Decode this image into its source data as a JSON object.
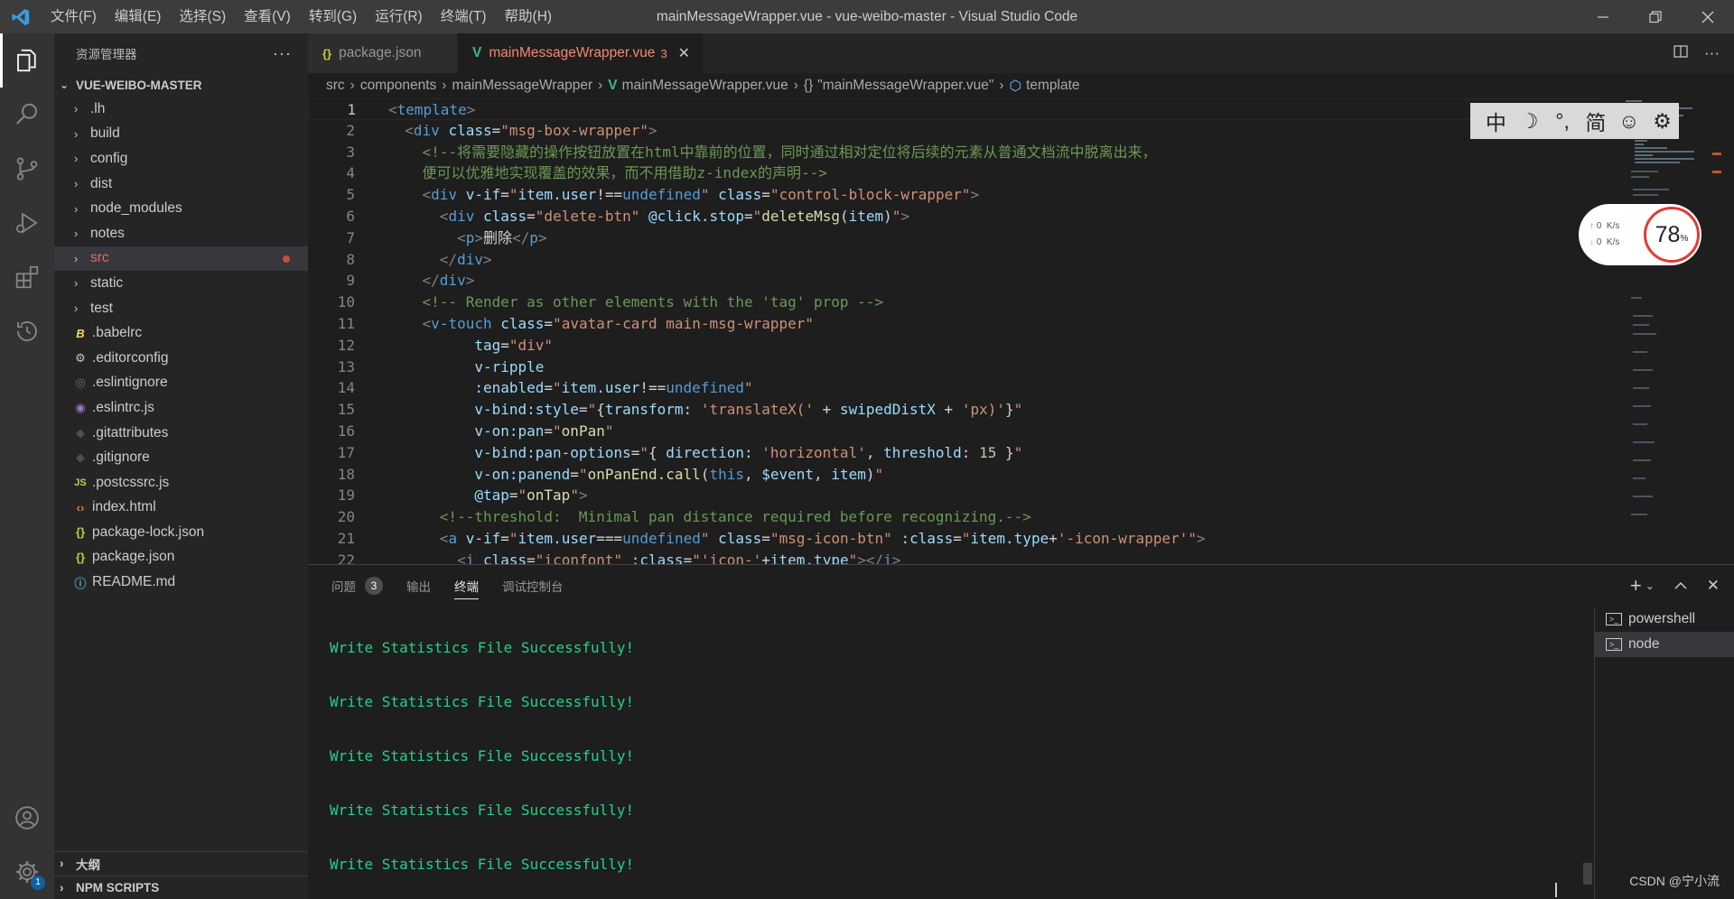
{
  "titlebar": {
    "menus": [
      "文件(F)",
      "编辑(E)",
      "选择(S)",
      "查看(V)",
      "转到(G)",
      "运行(R)",
      "终端(T)",
      "帮助(H)"
    ],
    "title": "mainMessageWrapper.vue - vue-weibo-master - Visual Studio Code"
  },
  "activity": {
    "settings_badge": "1"
  },
  "sidebar": {
    "header": "资源管理器",
    "more": "···",
    "root": "VUE-WEIBO-MASTER",
    "items": [
      {
        "label": ".lh",
        "type": "folder"
      },
      {
        "label": "build",
        "type": "folder"
      },
      {
        "label": "config",
        "type": "folder"
      },
      {
        "label": "dist",
        "type": "folder"
      },
      {
        "label": "node_modules",
        "type": "folder"
      },
      {
        "label": "notes",
        "type": "folder"
      },
      {
        "label": "src",
        "type": "folder"
      },
      {
        "label": "static",
        "type": "folder"
      },
      {
        "label": "test",
        "type": "folder"
      },
      {
        "label": ".babelrc",
        "type": "file"
      },
      {
        "label": ".editorconfig",
        "type": "file"
      },
      {
        "label": ".eslintignore",
        "type": "file"
      },
      {
        "label": ".eslintrc.js",
        "type": "file"
      },
      {
        "label": ".gitattributes",
        "type": "file"
      },
      {
        "label": ".gitignore",
        "type": "file"
      },
      {
        "label": ".postcssrc.js",
        "type": "file"
      },
      {
        "label": "index.html",
        "type": "file"
      },
      {
        "label": "package-lock.json",
        "type": "file"
      },
      {
        "label": "package.json",
        "type": "file"
      },
      {
        "label": "README.md",
        "type": "file"
      }
    ],
    "outline": "大纲",
    "npm": "NPM SCRIPTS"
  },
  "tabs": [
    {
      "label": "package.json",
      "icon": "{}"
    },
    {
      "label": "mainMessageWrapper.vue",
      "icon": "V",
      "errors": "3"
    }
  ],
  "breadcrumb": [
    "src",
    "components",
    "mainMessageWrapper",
    "mainMessageWrapper.vue",
    "\"mainMessageWrapper.vue\"",
    "template"
  ],
  "code": {
    "line_numbers": [
      "1",
      "2",
      "3",
      "4",
      "5",
      "6",
      "7",
      "8",
      "9",
      "10",
      "11",
      "12",
      "13",
      "14",
      "15",
      "16",
      "17",
      "18",
      "19",
      "20",
      "21",
      "22"
    ]
  },
  "ime": [
    "中",
    "☽",
    "°,",
    "简",
    "☺",
    "⚙"
  ],
  "net": {
    "up": "0",
    "down": "0",
    "unit": "K/s",
    "percent": "78",
    "pct_sign": "%"
  },
  "panel": {
    "tabs": [
      "问题",
      "输出",
      "终端",
      "调试控制台"
    ],
    "problems_count": "3",
    "terminal_lines": [
      "Write Statistics File Successfully!",
      "Write Statistics File Successfully!",
      "Write Statistics File Successfully!",
      "Write Statistics File Successfully!",
      "Write Statistics File Successfully!"
    ],
    "terminals": [
      "powershell",
      "node"
    ],
    "watermark": "CSDN @宁小流"
  }
}
